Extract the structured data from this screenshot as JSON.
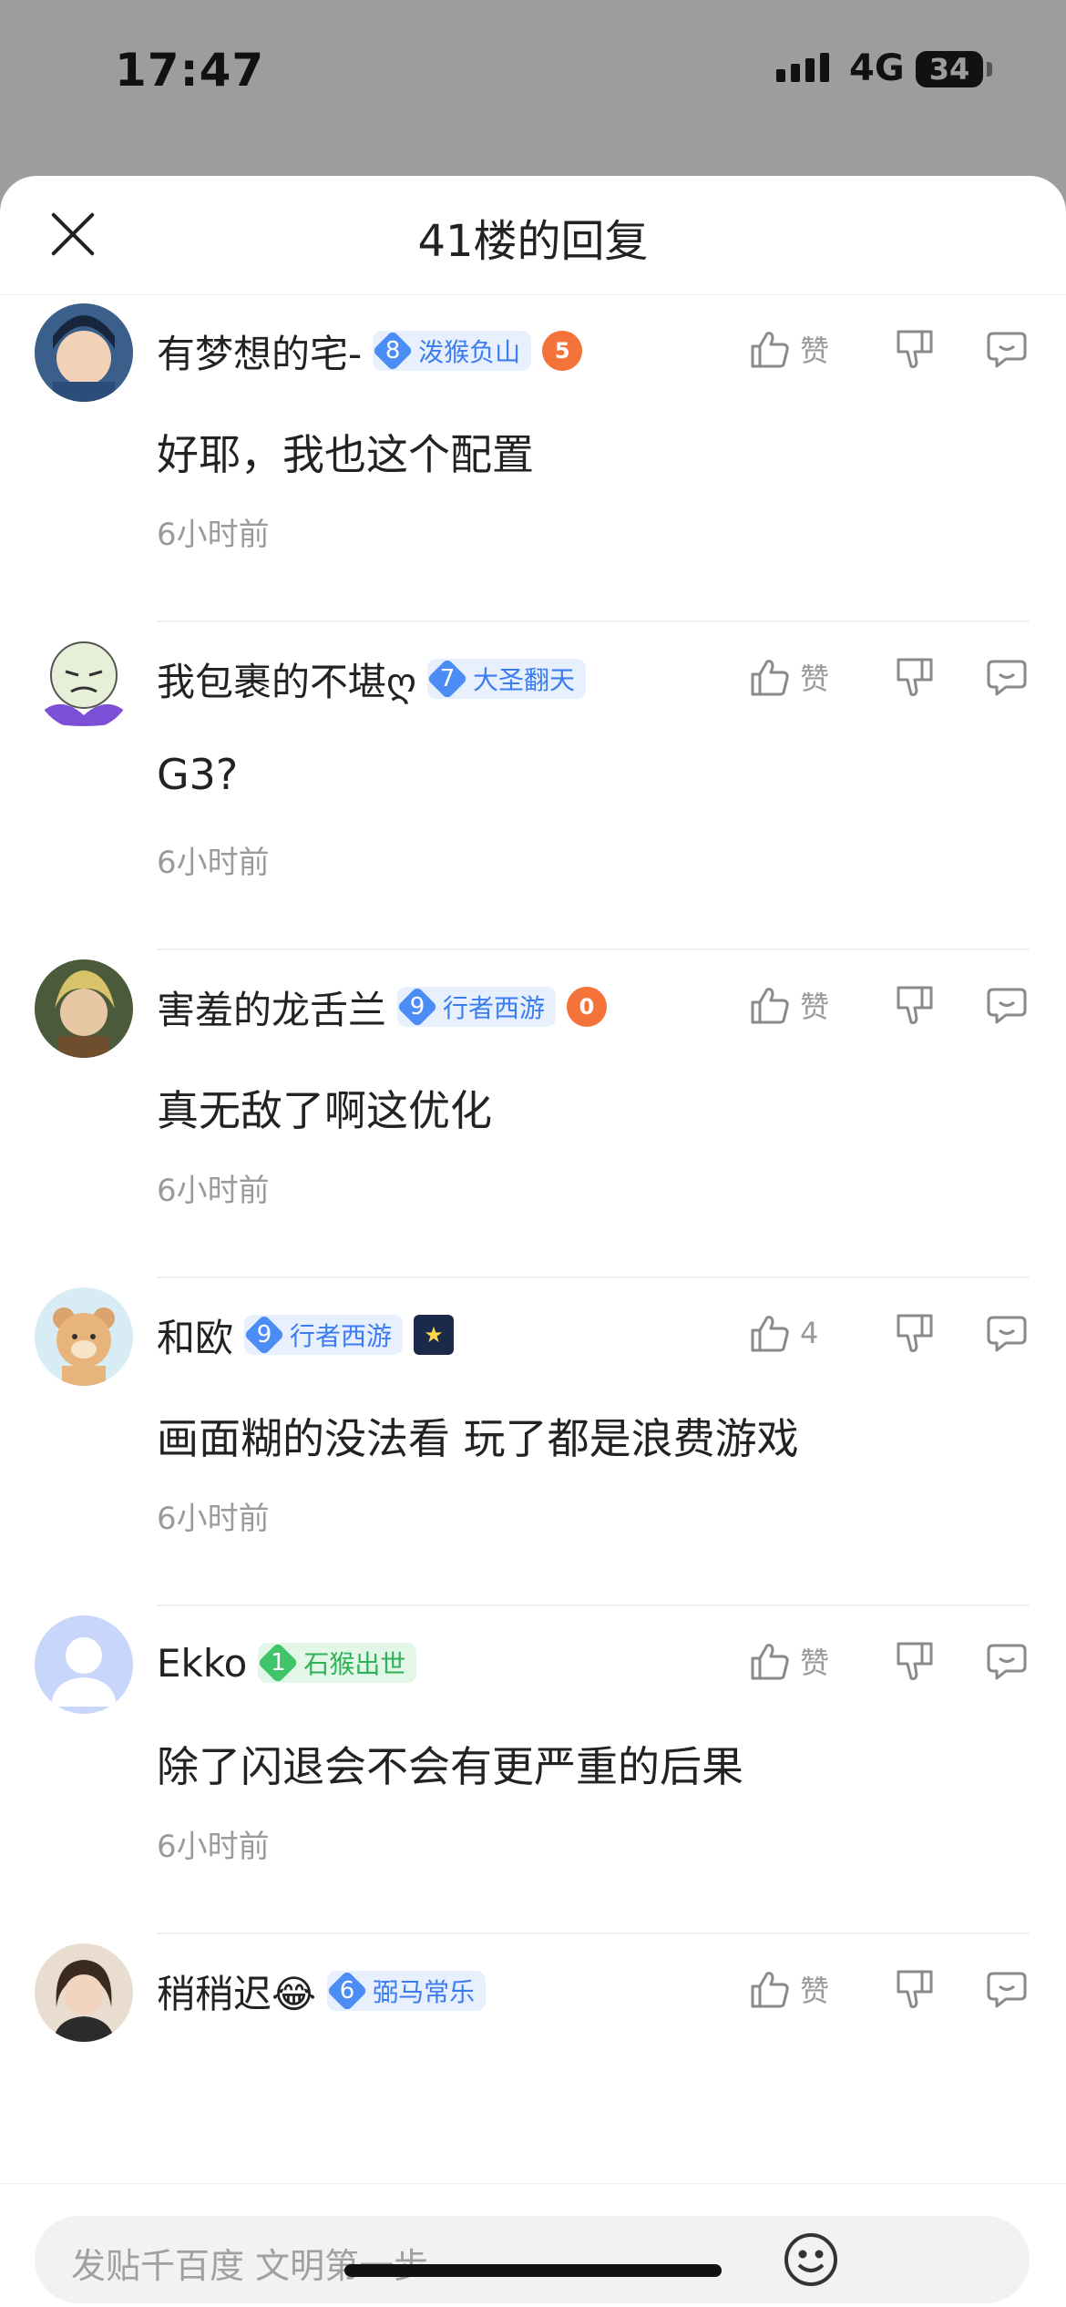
{
  "status_bar": {
    "time": "17:47",
    "network": "4G",
    "battery": "34"
  },
  "sheet": {
    "title": "41楼的回复"
  },
  "comments": [
    {
      "username": "有梦想的宅-",
      "level": "8",
      "badge": "泼猴负山",
      "badge_color": "blue",
      "emblem": "5",
      "text": "好耶，我也这个配置",
      "time": "6小时前",
      "likes": "赞"
    },
    {
      "username": "我包裹的不堪ღ",
      "level": "7",
      "badge": "大圣翻天",
      "badge_color": "blue",
      "emblem": "",
      "text": "G3?",
      "time": "6小时前",
      "likes": "赞"
    },
    {
      "username": "害羞的龙舌兰",
      "level": "9",
      "badge": "行者西游",
      "badge_color": "blue",
      "emblem": "0",
      "text": "真无敌了啊这优化",
      "time": "6小时前",
      "likes": "赞"
    },
    {
      "username": "和欧",
      "level": "9",
      "badge": "行者西游",
      "badge_color": "blue",
      "emblem": "★",
      "text": "画面糊的没法看 玩了都是浪费游戏",
      "time": "6小时前",
      "likes": "4"
    },
    {
      "username": "Ekko",
      "level": "1",
      "badge": "石猴出世",
      "badge_color": "green",
      "emblem": "",
      "text": "除了闪退会不会有更严重的后果",
      "time": "6小时前",
      "likes": "赞"
    },
    {
      "username": "稍稍迟😂",
      "level": "6",
      "badge": "弼马常乐",
      "badge_color": "blue",
      "emblem": "",
      "text": "",
      "time": "",
      "likes": "赞"
    }
  ],
  "input": {
    "placeholder": "发贴千百度 文明第一步"
  },
  "colors": {
    "accent_blue": "#3b7cf1",
    "accent_green": "#2fb257",
    "text_primary": "#222222",
    "text_secondary": "#9b9b9b"
  }
}
